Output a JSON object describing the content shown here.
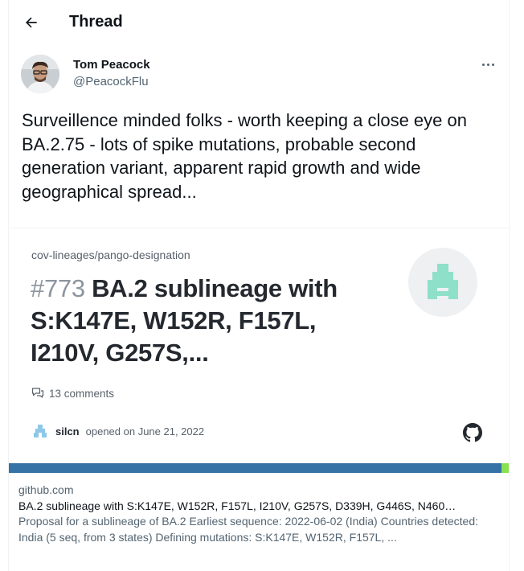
{
  "header": {
    "title": "Thread"
  },
  "author": {
    "name": "Tom Peacock",
    "handle": "@PeacockFlu"
  },
  "tweet": {
    "text": "Surveillence minded folks - worth keeping a close eye on BA.2.75 - lots of spike mutations, probable second generation variant, apparent rapid growth and wide geographical spread..."
  },
  "card": {
    "image": {
      "repo_path": "cov-lineages/pango-designation",
      "issue_number": "#773",
      "issue_title": "BA.2 sublineage with S:K147E, W152R, F157L, I210V, G257S,...",
      "comments": "13 comments",
      "opener_user": "silcn",
      "opened_text": "opened on June 21, 2022"
    },
    "domain": "github.com",
    "title": "BA.2 sublineage with S:K147E, W152R, F157L, I210V, G257S, D339H, G446S, N460…",
    "description": "Proposal for a sublineage of BA.2 Earliest sequence: 2022-06-02 (India) Countries detected: India (5 seq, from 3 states) Defining mutations: S:K147E, W152R, F157L, ..."
  },
  "colors": {
    "lang_primary": "#3572a5",
    "lang_secondary": "#89e051",
    "logo_mint": "#8ee0c9"
  }
}
